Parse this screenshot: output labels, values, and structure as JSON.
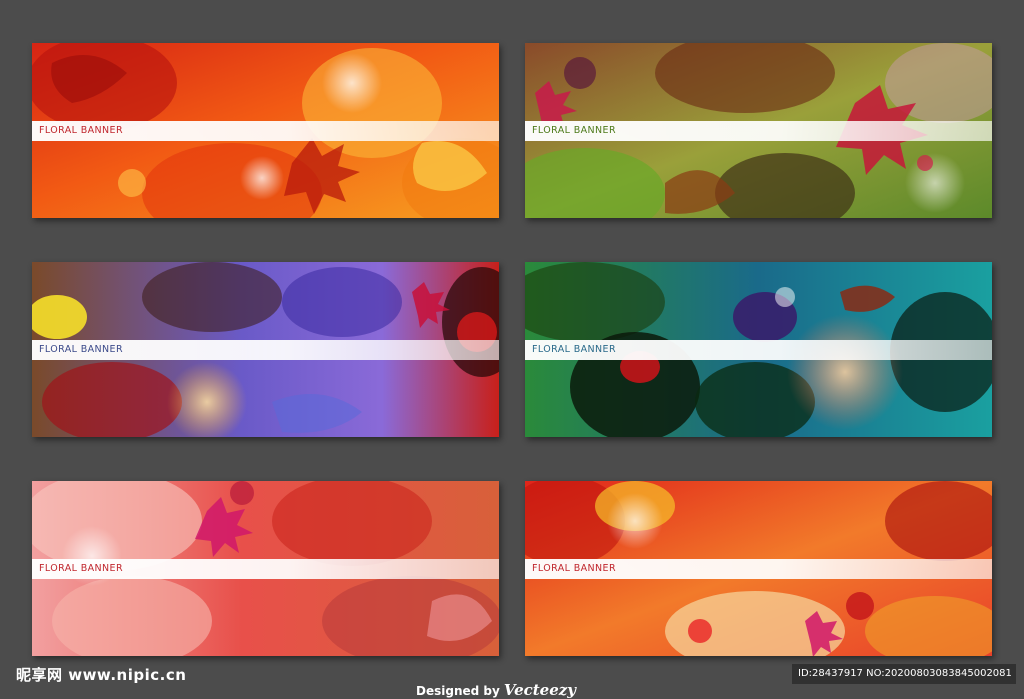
{
  "banners": [
    {
      "label": "FLORAL BANNER",
      "label_color": "#c0262d",
      "palette": [
        "#d42a1a",
        "#f6661a",
        "#f9a32a"
      ]
    },
    {
      "label": "FLORAL BANNER",
      "label_color": "#4d7a1a",
      "palette": [
        "#7b2a1a",
        "#a7b43a",
        "#d23a5a"
      ]
    },
    {
      "label": "FLORAL BANNER",
      "label_color": "#3b4a8a",
      "palette": [
        "#5a2a1a",
        "#6a5ad0",
        "#e83a2a"
      ]
    },
    {
      "label": "FLORAL BANNER",
      "label_color": "#2a6a8a",
      "palette": [
        "#1a5a3a",
        "#2aa0b0",
        "#f06a4a"
      ]
    },
    {
      "label": "FLORAL BANNER",
      "label_color": "#c0262d",
      "palette": [
        "#f08a8a",
        "#e04a2a",
        "#b03a3a"
      ]
    },
    {
      "label": "FLORAL BANNER",
      "label_color": "#c0262d",
      "palette": [
        "#e02a1a",
        "#f6a03a",
        "#f0c06a"
      ]
    }
  ],
  "watermarks": {
    "site": "昵享网 www.nipic.cn",
    "designed_by": "Designed by",
    "brand": "Vecteezy",
    "id_text": "ID:28437917 NO:20200803083845002081"
  }
}
